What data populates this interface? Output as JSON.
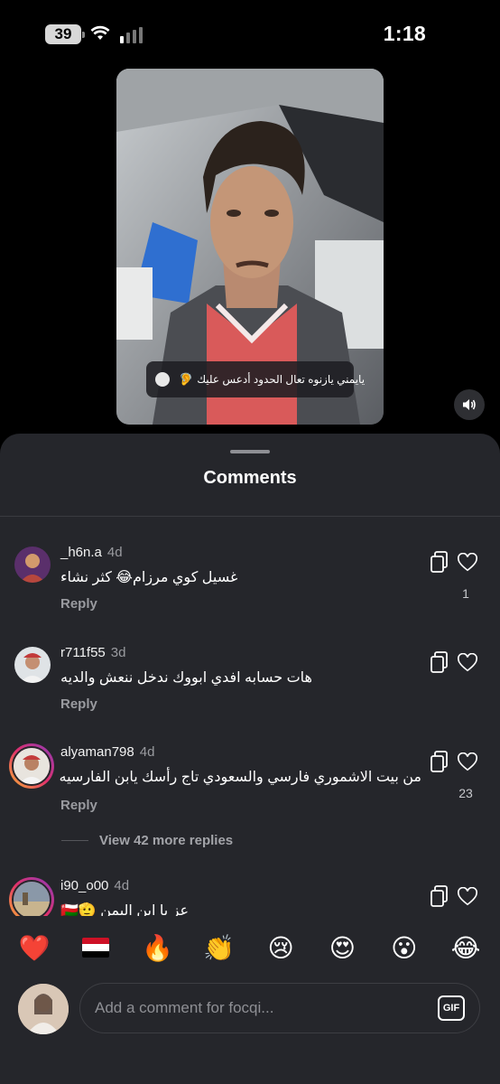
{
  "status_bar": {
    "battery_level": "39",
    "time": "1:18",
    "wifi_icon": "wifi-icon",
    "signal_icon": "cellular-signal-icon"
  },
  "video": {
    "caption_emoji": "🦻",
    "caption_text": "يايمني يازنوه تعال الحدود أدعس عليك",
    "mute_icon": "speaker-icon"
  },
  "comments_sheet": {
    "title": "Comments",
    "comments": [
      {
        "username": "_h6n.a",
        "time": "4d",
        "text": "غسيل كوي مرزام😂 كثر نشاء",
        "reply_label": "Reply",
        "likes": "1"
      },
      {
        "username": "r711f55",
        "time": "3d",
        "text": "هات حسابه افدي ابووك ندخل ننعش والديه",
        "reply_label": "Reply",
        "likes": ""
      },
      {
        "username": "alyaman798",
        "time": "4d",
        "text": "من بيت الاشموري فارسي والسعودي تاج رأسك يابن الفارسيه",
        "reply_label": "Reply",
        "likes": "23"
      },
      {
        "username": "i90_o00",
        "time": "4d",
        "text": "عز يا ابن اليمن 🫡🇴🇲",
        "reply_label": "",
        "likes": ""
      }
    ],
    "view_more_label": "View 42 more replies"
  },
  "emoji_bar": [
    "❤️",
    "yemen-flag",
    "🔥",
    "👏",
    "😢",
    "😍",
    "😮",
    "😂"
  ],
  "composer": {
    "placeholder": "Add a comment for focqi...",
    "gif_label": "GIF"
  },
  "colors": {
    "sheet_bg": "#25262b",
    "secondary_text": "#9a9ba0",
    "story_ring": "#e1306c"
  }
}
